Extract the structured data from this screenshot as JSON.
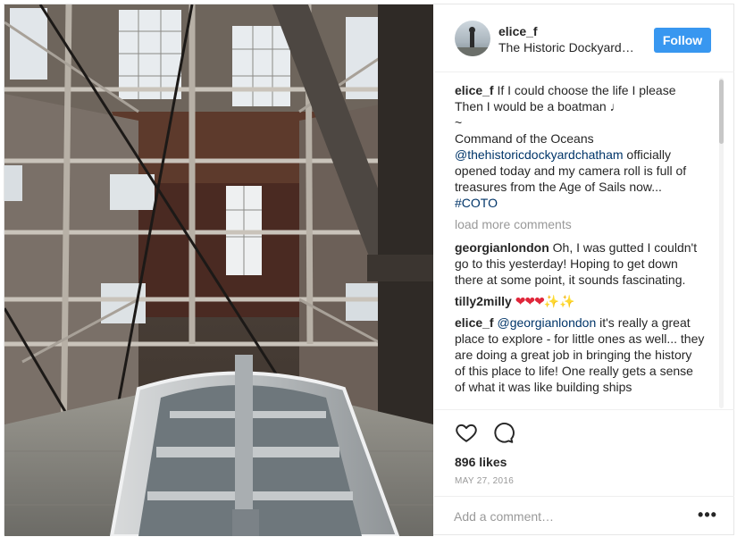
{
  "header": {
    "username": "elice_f",
    "location": "The Historic Dockyard…",
    "follow_label": "Follow"
  },
  "caption": {
    "username": "elice_f",
    "text_line1": "If I could choose the life I please Then I would be a boatman ♩",
    "text_line2": "~",
    "text_line3": "Command of the Oceans",
    "mention": "@thehistoricdockyardchatham",
    "text_line4": "officially opened today and my camera roll is full of treasures from the Age of Sails now...",
    "hashtag": "#COTO"
  },
  "load_more_label": "load more comments",
  "comments": [
    {
      "username": "georgianlondon",
      "text": "Oh, I was gutted I couldn't go to this yesterday! Hoping to get down there at some point, it sounds fascinating."
    },
    {
      "username": "tilly2milly",
      "hearts": "❤❤❤",
      "sparkles": "✨✨"
    },
    {
      "username": "elice_f",
      "mention": "@georgianlondon",
      "text": "it's really a great place to explore - for little ones as well... they are doing a great job in bringing the history of this place to life! One really gets a sense of what it was like building ships"
    }
  ],
  "likes": "896 likes",
  "date": "MAY 27, 2016",
  "add_comment_placeholder": "Add a comment…",
  "more_label": "•••",
  "icons": {
    "like": "heart-outline-icon",
    "comment": "speech-bubble-icon",
    "more": "ellipsis-icon"
  },
  "colors": {
    "follow_button": "#3897f0",
    "mention": "#003569",
    "muted": "#999999"
  }
}
